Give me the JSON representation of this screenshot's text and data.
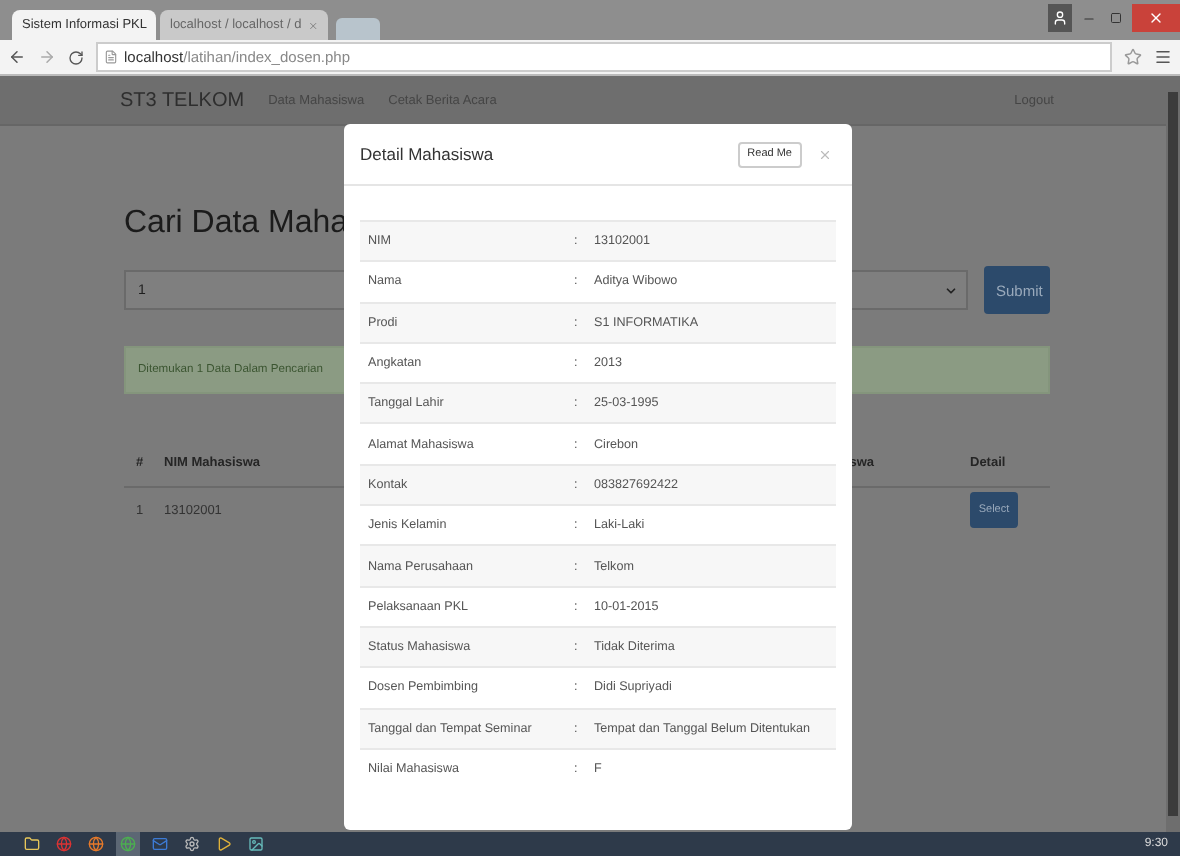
{
  "browser": {
    "tabs": [
      {
        "title": "Sistem Informasi PKL",
        "selected": true
      },
      {
        "title": "localhost / localhost / d",
        "selected": false
      }
    ],
    "url": "**localhost**/latihan/index_dosen.php"
  },
  "navbar": {
    "brand": "ST3 TELKOM",
    "links": [
      "Data Mahasiswa",
      "Cetak Berita Acara"
    ],
    "logout": "Logout"
  },
  "page": {
    "heading": "Cari Data Maha",
    "search": {
      "value": "1"
    },
    "submit": "Submit",
    "alert": "Ditemukan 1 Data Dalam Pencarian",
    "table": {
      "columns": [
        "#",
        "NIM Mahasiswa",
        "swa",
        "Detail"
      ],
      "rows": [
        {
          "cells": [
            "1",
            "13102001"
          ],
          "action": "Select"
        }
      ]
    }
  },
  "modal": {
    "title": "Detail Mahasiswa",
    "read_me": "Read Me",
    "rows": [
      {
        "label": "NIM",
        "sep": ":",
        "value": "13102001"
      },
      {
        "label": "Nama",
        "sep": ":",
        "value": "Aditya Wibowo"
      },
      {
        "label": "Prodi",
        "sep": ":",
        "value": "S1 INFORMATIKA"
      },
      {
        "label": "Angkatan",
        "sep": ":",
        "value": "2013"
      },
      {
        "label": "Tanggal Lahir",
        "sep": ":",
        "value": "25-03-1995"
      },
      {
        "label": "Alamat Mahasiswa",
        "sep": ":",
        "value": "Cirebon"
      },
      {
        "label": "Kontak",
        "sep": ":",
        "value": "083827692422"
      },
      {
        "label": "Jenis Kelamin",
        "sep": ":",
        "value": "Laki-Laki"
      },
      {
        "label": "Nama Perusahaan",
        "sep": ":",
        "value": "Telkom"
      },
      {
        "label": "Pelaksanaan PKL",
        "sep": ":",
        "value": "10-01-2015"
      },
      {
        "label": "Status Mahasiswa",
        "sep": ":",
        "value": "Tidak Diterima"
      },
      {
        "label": "Dosen Pembimbing",
        "sep": ":",
        "value": "Didi Supriyadi"
      },
      {
        "label": "Tanggal dan Tempat Seminar",
        "sep": ":",
        "value": "Tempat dan Tanggal Belum Ditentukan"
      },
      {
        "label": "Nilai Mahasiswa",
        "sep": ":",
        "value": "F"
      }
    ]
  },
  "taskbar": {
    "clock": "9:30"
  }
}
